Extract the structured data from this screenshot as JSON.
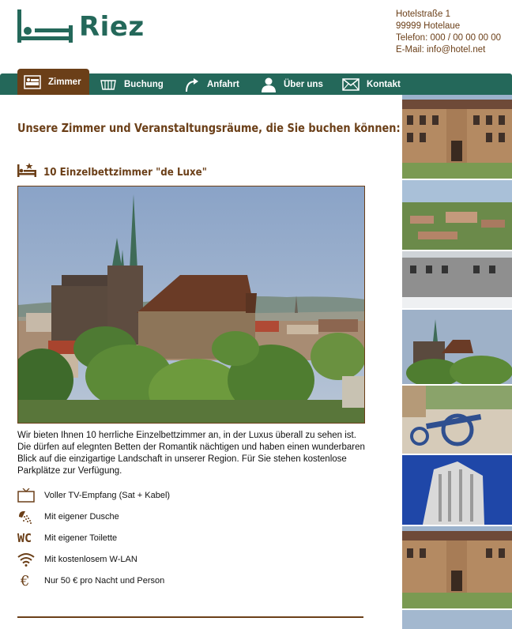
{
  "brand": {
    "name": "Riez",
    "logo_icon": "bed-icon",
    "color": "#24685a"
  },
  "address": {
    "street": "Hotelstraße 1",
    "city": "99999 Hotelaue",
    "phone": "Telefon: 000 / 00 00 00 00",
    "email": "E-Mail: info@hotel.net"
  },
  "nav": {
    "items": [
      {
        "label": "Zimmer",
        "icon": "bed-icon",
        "active": true
      },
      {
        "label": "Buchung",
        "icon": "calendar-icon",
        "active": false
      },
      {
        "label": "Anfahrt",
        "icon": "arrow-turn-icon",
        "active": false
      },
      {
        "label": "Über uns",
        "icon": "person-icon",
        "active": false
      },
      {
        "label": "Kontakt",
        "icon": "mail-icon",
        "active": false
      }
    ]
  },
  "main": {
    "title": "Unsere Zimmer und Veranstaltungsräume, die Sie buchen können:",
    "room": {
      "title": "10 Einzelbettzimmer \"de Luxe\"",
      "icon": "bed-star-icon",
      "description": "Wir bieten Ihnen 10 herrliche Einzelbettzimmer an, in der Luxus überall zu sehen ist. Die dürfen auf elegnten Betten der Romantik nächtigen und haben einen wunderbaren Blick auf die einzigartige Landschaft in unserer Region. Für Sie stehen kostenlose Parkplätze zur Verfügung.",
      "features": [
        {
          "label": "Voller TV-Empfang (Sat + Kabel)",
          "icon": "tv-icon"
        },
        {
          "label": "Mit eigener Dusche",
          "icon": "shower-icon"
        },
        {
          "label": "Mit eigener Toilette",
          "icon": "wc-icon"
        },
        {
          "label": "Mit kostenlosem W-LAN",
          "icon": "wifi-icon"
        },
        {
          "label": "Nur 50 € pro Nacht und Person",
          "icon": "euro-icon"
        }
      ],
      "wc_text": "WC",
      "euro_text": "€"
    }
  },
  "colors": {
    "primary": "#24685a",
    "accent": "#6b3f18"
  }
}
